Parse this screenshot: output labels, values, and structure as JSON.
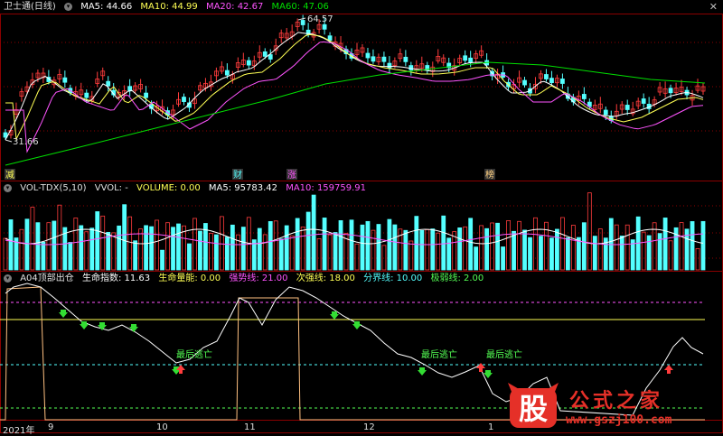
{
  "panel1": {
    "title": "卫士通(日线)",
    "ma5": "MA5: 44.66",
    "ma10": "MA10: 44.99",
    "ma20": "MA20: 42.67",
    "ma60": "MA60: 47.06",
    "high_label": "64.57",
    "low_label": "31.66",
    "markers": [
      "减",
      "财",
      "涨",
      "榜"
    ]
  },
  "panel2": {
    "title": "VOL-TDX(5,10)",
    "vvol": "VVOL: -",
    "volume": "VOLUME: 0.00",
    "ma5": "MA5: 95783.42",
    "ma10": "MA10: 159759.91"
  },
  "panel3": {
    "title": "A04顶部出仓",
    "life_index": "生命指数: 11.63",
    "life_energy": "生命量能: 0.00",
    "strong_line": "强势线: 21.00",
    "second_strong": "次强线: 18.00",
    "boundary": "分界线: 10.00",
    "weak": "极弱线: 2.00",
    "escape_label": "最后逃亡"
  },
  "x_axis": {
    "labels": [
      "2021年",
      "9",
      "10",
      "11",
      "12",
      "1"
    ]
  },
  "watermark": {
    "logo_char": "股",
    "text": "公式之家",
    "url": "www.gszj100.com"
  },
  "colors": {
    "up": "#ff3c3c",
    "down": "#54ffff",
    "ma5": "#ffffff",
    "ma10": "#ffff54",
    "ma20": "#ff54ff",
    "ma60": "#00e000",
    "grid": "#8b0000"
  },
  "chart_data": {
    "type": "candlestick",
    "price_range": [
      31.66,
      64.57
    ],
    "volume_ma5": 95783.42,
    "volume_ma10": 159759.91,
    "life_index_levels": {
      "strong": 21,
      "second_strong": 18,
      "boundary": 10,
      "weak": 2
    },
    "life_index_last": 11.63
  }
}
